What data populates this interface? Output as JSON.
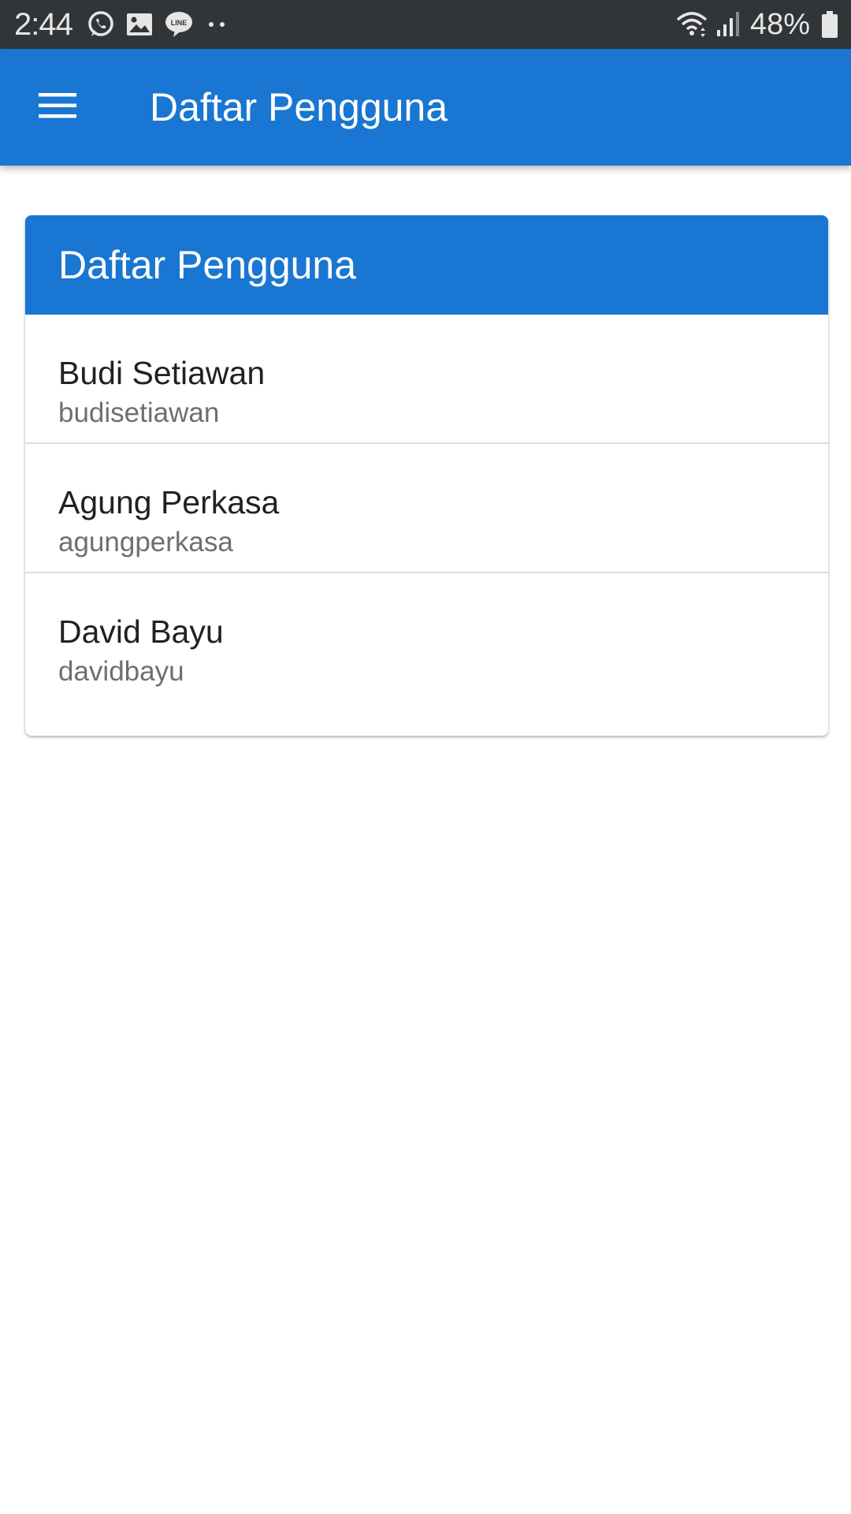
{
  "status_bar": {
    "time": "2:44",
    "battery": "48%",
    "left_icons": [
      "whatsapp-icon",
      "gallery-icon",
      "line-icon",
      "more-dots-icon"
    ],
    "right_icons": [
      "wifi-icon",
      "signal-icon",
      "battery-icon"
    ]
  },
  "app_bar": {
    "title": "Daftar Pengguna",
    "menu_icon": "hamburger-menu-icon",
    "color": "#1976d2"
  },
  "card": {
    "title": "Daftar Pengguna",
    "users": [
      {
        "name": "Budi Setiawan",
        "username": "budisetiawan"
      },
      {
        "name": "Agung Perkasa",
        "username": "agungperkasa"
      },
      {
        "name": "David Bayu",
        "username": "davidbayu"
      }
    ]
  }
}
